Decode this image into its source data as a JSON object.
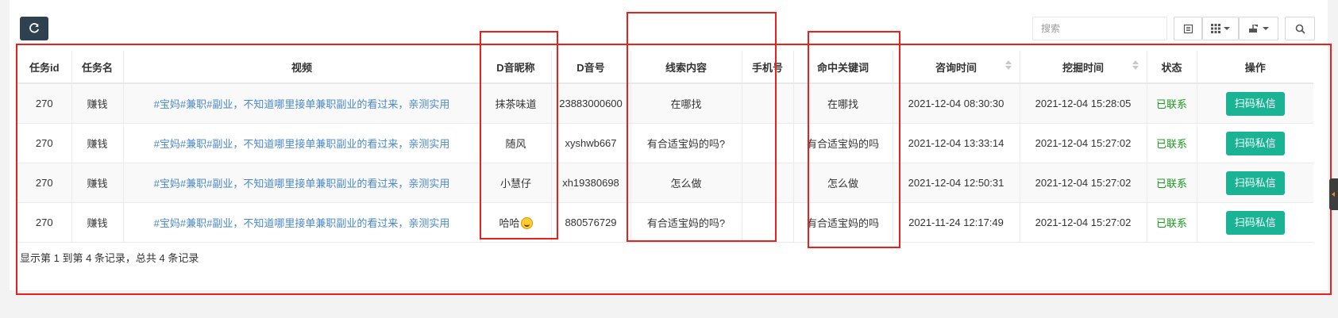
{
  "search": {
    "placeholder": "搜索"
  },
  "toolbar": {
    "refresh_icon": "refresh-icon",
    "tools": [
      "list-icon",
      "grid-columns-icon",
      "export-icon",
      "search-icon"
    ]
  },
  "table": {
    "columns": [
      "任务id",
      "任务名",
      "视频",
      "D音昵称",
      "D音号",
      "线索内容",
      "手机号",
      "命中关键词",
      "咨询时间",
      "挖掘时间",
      "状态",
      "操作"
    ],
    "rows": [
      {
        "task_id": "270",
        "task_name": "赚钱",
        "video": "#宝妈#兼职#副业，不知道哪里接单兼职副业的看过来，亲测实用",
        "nickname": "抹茶味道",
        "account": "23883000600",
        "clue": "在哪找",
        "phone": "",
        "keyword": "在哪找",
        "consult_time": "2021-12-04 08:30:30",
        "mine_time": "2021-12-04 15:28:05",
        "status": "已联系",
        "action": "扫码私信"
      },
      {
        "task_id": "270",
        "task_name": "赚钱",
        "video": "#宝妈#兼职#副业，不知道哪里接单兼职副业的看过来，亲测实用",
        "nickname": "随风",
        "account": "xyshwb667",
        "clue": "有合适宝妈的吗?",
        "phone": "",
        "keyword": "有合适宝妈的吗",
        "consult_time": "2021-12-04 13:33:14",
        "mine_time": "2021-12-04 15:27:02",
        "status": "已联系",
        "action": "扫码私信"
      },
      {
        "task_id": "270",
        "task_name": "赚钱",
        "video": "#宝妈#兼职#副业，不知道哪里接单兼职副业的看过来，亲测实用",
        "nickname": "小慧仔",
        "account": "xh19380698",
        "clue": "怎么做",
        "phone": "",
        "keyword": "怎么做",
        "consult_time": "2021-12-04 12:50:31",
        "mine_time": "2021-12-04 15:27:02",
        "status": "已联系",
        "action": "扫码私信"
      },
      {
        "task_id": "270",
        "task_name": "赚钱",
        "video": "#宝妈#兼职#副业，不知道哪里接单兼职副业的看过来，亲测实用",
        "nickname": "哈哈",
        "account": "880576729",
        "clue": "有合适宝妈的吗?",
        "phone": "",
        "keyword": "有合适宝妈的吗",
        "consult_time": "2021-11-24 12:17:49",
        "mine_time": "2021-12-04 15:27:02",
        "status": "已联系",
        "action": "扫码私信"
      }
    ]
  },
  "pagination": {
    "summary": "显示第 1 到第 4 条记录，总共 4 条记录"
  },
  "colors": {
    "highlight_box": "#e8211d",
    "action_button": "#1ab394",
    "status_text": "#1a9c1a",
    "link_text": "#4a89c8",
    "refresh_button": "#2f4050"
  }
}
